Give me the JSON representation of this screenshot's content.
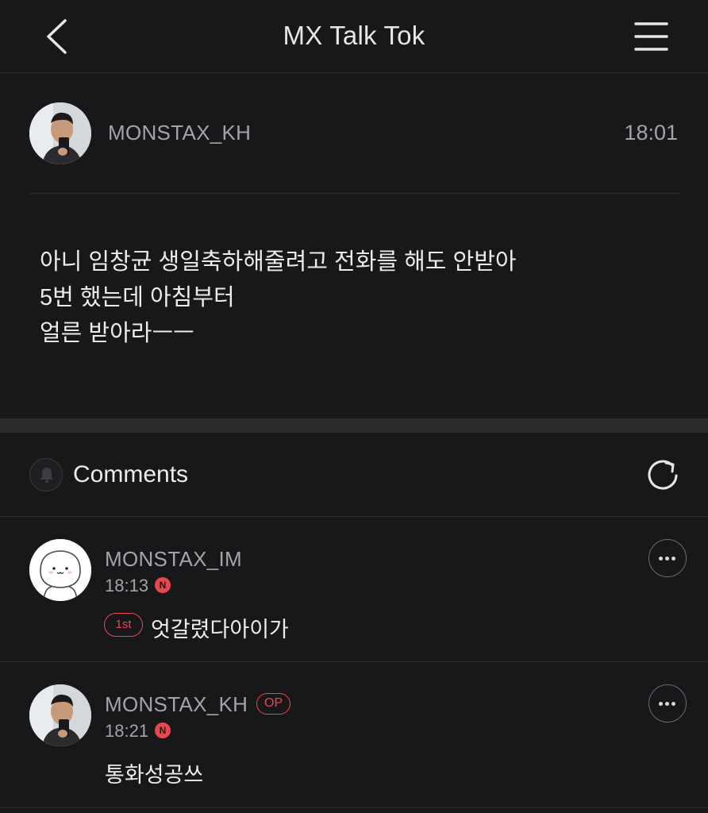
{
  "header": {
    "title": "MX Talk Tok",
    "back_icon": "chevron-left-icon",
    "menu_icon": "hamburger-menu-icon"
  },
  "post": {
    "author": "MONSTAX_KH",
    "time": "18:01",
    "lines": [
      "아니 임창균 생일축하해줄려고 전화를 해도 안받아",
      "5번 했는데 아침부터",
      "얼른 받아라ㅡㅡ"
    ]
  },
  "comments_section": {
    "title": "Comments",
    "bell_icon": "bell-icon",
    "refresh_icon": "refresh-icon"
  },
  "comments": [
    {
      "username": "MONSTAX_IM",
      "time": "18:13",
      "new_badge": "N",
      "rank_badge": "1st",
      "text": "엇갈렸다아이가"
    },
    {
      "username": "MONSTAX_KH",
      "op_badge": "OP",
      "time": "18:21",
      "new_badge": "N",
      "text": "통화성공쓰"
    }
  ],
  "colors": {
    "background": "#18181b",
    "divider": "#2e2e33",
    "accent": "#e9474f",
    "muted_text": "#a3a3a8"
  }
}
